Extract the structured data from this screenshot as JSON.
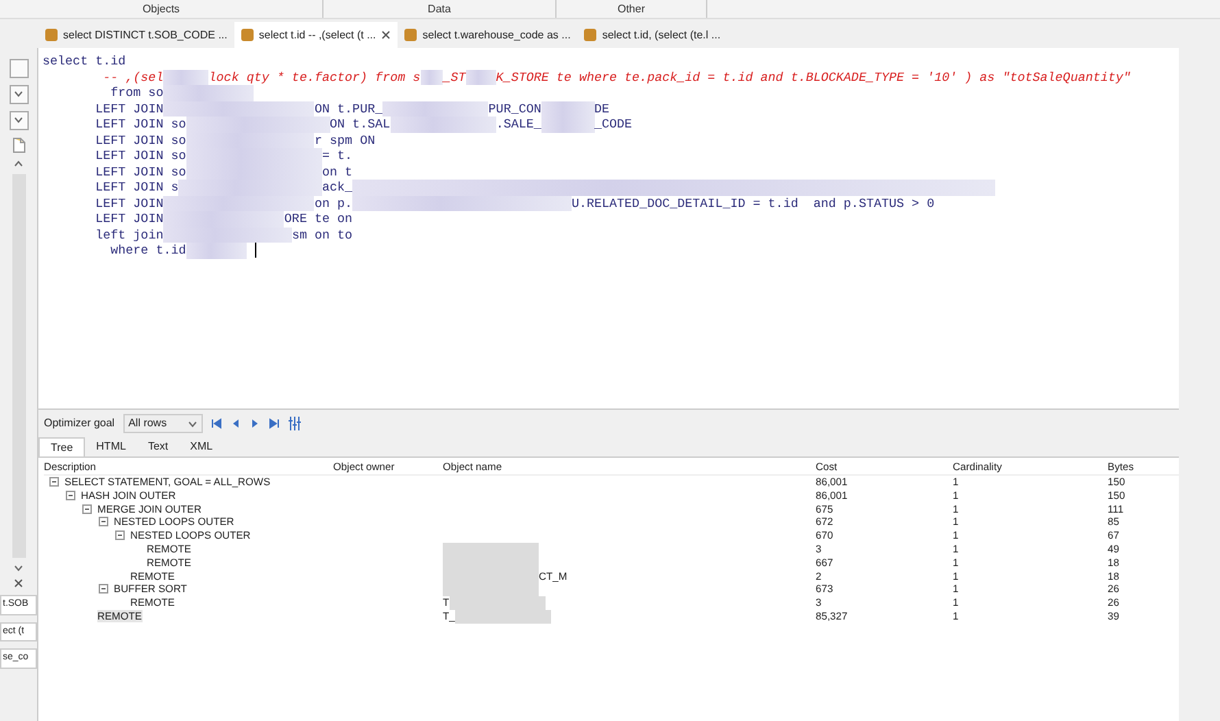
{
  "header_sections": [
    "Objects",
    "Data",
    "Other"
  ],
  "side_tabs": [
    {
      "label": "t.SOB"
    },
    {
      "label": "ect (t"
    },
    {
      "label": "se_co"
    }
  ],
  "tabs": [
    {
      "label": "select DISTINCT t.SOB_CODE ...",
      "selected": false,
      "closable": false
    },
    {
      "label": "select t.id -- ,(select (t ...",
      "selected": true,
      "closable": true
    },
    {
      "label": "select t.warehouse_code as ...",
      "selected": false,
      "closable": false
    },
    {
      "label": "select t.id, (select (te.l ...",
      "selected": false,
      "closable": false
    }
  ],
  "editor_lines": [
    {
      "parts": [
        {
          "text": "select t.id",
          "kind": "code"
        }
      ]
    },
    {
      "parts": [
        {
          "text": "-- ,(sel",
          "kind": "comment"
        },
        {
          "text": "lock qty * te.factor) from s",
          "kind": "comment"
        },
        {
          "text": "_ST",
          "kind": "comment"
        },
        {
          "text": "K_STORE te where te.pack_id = t.id and t.BLOCKADE_TYPE = '10' ) as \"totSaleQuantity\"",
          "kind": "comment"
        }
      ]
    },
    {
      "parts": [
        {
          "text": "from so",
          "kind": "code"
        }
      ]
    },
    {
      "parts": [
        {
          "text": "LEFT JOIN",
          "kind": "code"
        },
        {
          "text": "ON t.PUR_",
          "kind": "code"
        },
        {
          "text": "PUR_CON",
          "kind": "code"
        },
        {
          "text": "DE",
          "kind": "code"
        }
      ]
    },
    {
      "parts": [
        {
          "text": "LEFT JOIN so",
          "kind": "code"
        },
        {
          "text": "ON t.SAL",
          "kind": "code"
        },
        {
          "text": ".SALE_",
          "kind": "code"
        },
        {
          "text": "_CODE",
          "kind": "code"
        }
      ]
    },
    {
      "parts": [
        {
          "text": "LEFT JOIN so",
          "kind": "code"
        },
        {
          "text": "r spm ON",
          "kind": "code"
        }
      ]
    },
    {
      "parts": [
        {
          "text": "LEFT JOIN so",
          "kind": "code"
        },
        {
          "text": "= t.",
          "kind": "code"
        }
      ]
    },
    {
      "parts": [
        {
          "text": "LEFT JOIN so",
          "kind": "code"
        },
        {
          "text": "on t",
          "kind": "code"
        }
      ]
    },
    {
      "parts": [
        {
          "text": "LEFT JOIN s",
          "kind": "code"
        },
        {
          "text": "ack_",
          "kind": "code"
        }
      ]
    },
    {
      "parts": [
        {
          "text": "LEFT JOIN",
          "kind": "code"
        },
        {
          "text": "on p.",
          "kind": "code"
        },
        {
          "text": "U.RELATED_DOC_DETAIL_ID = t.id  and p.STATUS > 0",
          "kind": "code"
        }
      ]
    },
    {
      "parts": [
        {
          "text": "LEFT JOIN",
          "kind": "code"
        },
        {
          "text": "ORE te on",
          "kind": "code"
        }
      ]
    },
    {
      "parts": [
        {
          "text": "left join",
          "kind": "code"
        },
        {
          "text": "sm on to",
          "kind": "code"
        }
      ]
    },
    {
      "parts": [
        {
          "text": "where t.id",
          "kind": "code"
        }
      ]
    }
  ],
  "plan_toolbar": {
    "label": "Optimizer goal",
    "goal": "All rows"
  },
  "plan_tabs": [
    {
      "label": "Tree",
      "selected": true
    },
    {
      "label": "HTML",
      "selected": false
    },
    {
      "label": "Text",
      "selected": false
    },
    {
      "label": "XML",
      "selected": false
    }
  ],
  "plan_table": {
    "columns": [
      "Description",
      "Object owner",
      "Object name",
      "Cost",
      "Cardinality",
      "Bytes"
    ],
    "rows": [
      {
        "description": "SELECT STATEMENT, GOAL = ALL_ROWS",
        "cost": "86,001",
        "cardinality": "1",
        "bytes": "150",
        "selected": false,
        "expanded": true,
        "children": [
          {
            "description": "HASH JOIN OUTER",
            "cost": "86,001",
            "cardinality": "1",
            "bytes": "150",
            "selected": false,
            "expanded": true,
            "children": [
              {
                "description": "MERGE JOIN OUTER",
                "cost": "675",
                "cardinality": "1",
                "bytes": "111",
                "selected": false,
                "expanded": true,
                "children": [
                  {
                    "description": "NESTED LOOPS OUTER",
                    "cost": "672",
                    "cardinality": "1",
                    "bytes": "85",
                    "selected": false,
                    "expanded": true,
                    "children": [
                      {
                        "description": "NESTED LOOPS OUTER",
                        "cost": "670",
                        "cardinality": "1",
                        "bytes": "67",
                        "selected": false,
                        "expanded": true,
                        "children": [
                          {
                            "description": "REMOTE",
                            "cost": "3",
                            "cardinality": "1",
                            "bytes": "49",
                            "selected": false
                          },
                          {
                            "description": "REMOTE",
                            "cost": "667",
                            "cardinality": "1",
                            "bytes": "18",
                            "selected": false
                          }
                        ]
                      },
                      {
                        "description": "REMOTE",
                        "object_name": "CT_M",
                        "cost": "2",
                        "cardinality": "1",
                        "bytes": "18",
                        "selected": false
                      }
                    ]
                  },
                  {
                    "description": "BUFFER SORT",
                    "cost": "673",
                    "cardinality": "1",
                    "bytes": "26",
                    "selected": false,
                    "expanded": true,
                    "children": [
                      {
                        "description": "REMOTE",
                        "object_name": "T",
                        "cost": "3",
                        "cardinality": "1",
                        "bytes": "26",
                        "selected": false
                      }
                    ]
                  }
                ]
              },
              {
                "description": "REMOTE",
                "object_name": "T_",
                "cost": "85,327",
                "cardinality": "1",
                "bytes": "39",
                "selected": true
              }
            ]
          }
        ]
      }
    ]
  }
}
